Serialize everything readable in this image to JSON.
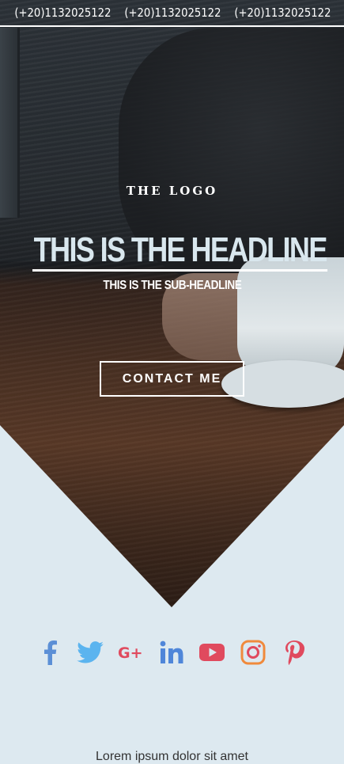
{
  "topbar": {
    "phones": [
      "(+20)1132025122",
      "(+20)1132025122",
      "(+20)1132025122"
    ]
  },
  "hero": {
    "logo": "THE LOGO",
    "headline": "THIS IS THE HEADLINE",
    "subheadline": "THIS IS THE SUB-HEADLINE",
    "cta_label": "CONTACT ME"
  },
  "social": {
    "icons": [
      "facebook-icon",
      "twitter-icon",
      "google-plus-icon",
      "linkedin-icon",
      "youtube-icon",
      "instagram-icon",
      "pinterest-icon"
    ],
    "colors": {
      "facebook": "#5b8fd6",
      "twitter": "#5bb4ef",
      "google_plus": "#e04a5e",
      "linkedin": "#4f86d9",
      "youtube": "#e04a5e",
      "instagram": "#f08a3c",
      "pinterest": "#e04a5e"
    }
  },
  "body_text": "Lorem ipsum dolor sit amet",
  "colors": {
    "page_background": "#dde9f0",
    "headline_text": "#d9e7ee",
    "white": "#ffffff"
  }
}
